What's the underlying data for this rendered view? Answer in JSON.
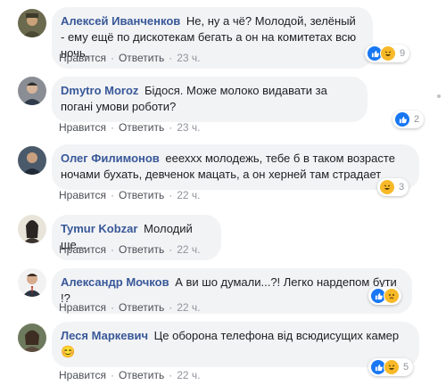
{
  "comments": [
    {
      "author": "Алексей Иванченков",
      "text": "Не, ну а чё? Молодой, зелёный - ему ещё по дискотекам бегать а он на комитетах всю ночь.",
      "like": "Нравится",
      "reply": "Ответить",
      "time": "23 ч.",
      "reaction_icons": [
        "like-icon",
        "haha-icon"
      ],
      "reaction_count": "9"
    },
    {
      "author": "Dmytro Moroz",
      "text": "Бідося. Може молоко видавати за погані умови роботи?",
      "like": "Нравится",
      "reply": "Ответить",
      "time": "23 ч.",
      "reaction_icons": [
        "like-icon"
      ],
      "reaction_count": "2"
    },
    {
      "author": "Олег Филимонов",
      "text": "еееххх молодежь, тебе б в таком возрасте ночами бухать, девченок мацать, а он херней там страдает",
      "like": "Нравится",
      "reply": "Ответить",
      "time": "22 ч.",
      "reaction_icons": [
        "haha-icon"
      ],
      "reaction_count": "3"
    },
    {
      "author": "Tymur Kobzar",
      "text": "Молодий ще...",
      "like": "Нравится",
      "reply": "Ответить",
      "time": "22 ч.",
      "reaction_icons": [],
      "reaction_count": ""
    },
    {
      "author": "Александр Мочков",
      "text": "А ви шо думали...?! Легко нардепом бути !?",
      "like": "Нравится",
      "reply": "Ответить",
      "time": "22 ч.",
      "reaction_icons": [
        "like-icon",
        "sad-icon"
      ],
      "reaction_count": ""
    },
    {
      "author": "Леся Маркевич",
      "text": "Це оборона телефона від всюдисущих камер",
      "emoji": "😊",
      "like": "Нравится",
      "reply": "Ответить",
      "time": "22 ч.",
      "reaction_icons": [
        "like-icon",
        "haha-icon"
      ],
      "reaction_count": "5"
    }
  ],
  "colors": {
    "author": "#385898",
    "bubble": "#f2f3f5",
    "meta": "#90949c",
    "like_blue": "#1877f2",
    "haha_yellow": "#f7b928"
  }
}
